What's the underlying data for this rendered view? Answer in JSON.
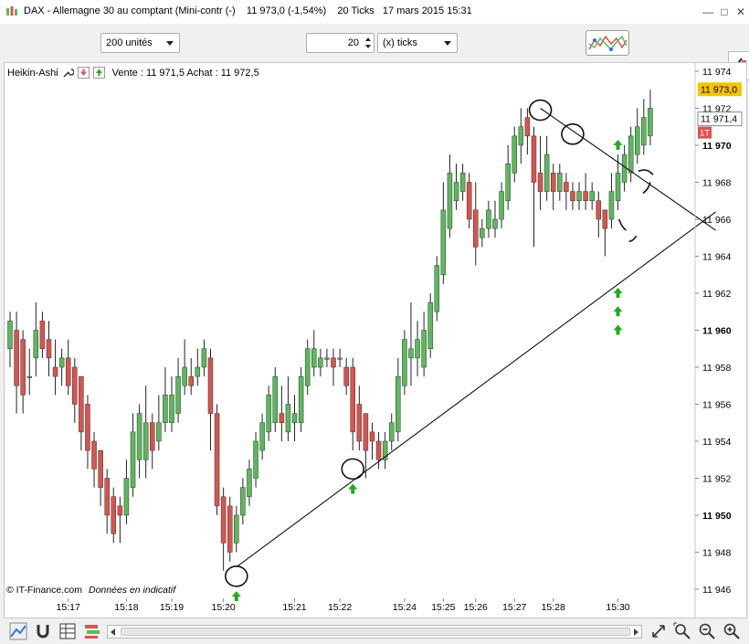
{
  "window": {
    "title": "DAX - Allemagne 30 au comptant (Mini-contr (-)    11 973,0 (-1,54%)    20 Ticks   17 mars 2015 15:31"
  },
  "toolbar": {
    "units_select": "200 unités",
    "ticks_value": "20",
    "ticks_select": "(x) ticks"
  },
  "legend": {
    "indicator": "Heikin-Ashi",
    "quote": "Vente : 11 971,5  Achat : 11 972,5"
  },
  "price_axis": {
    "labels": [
      "11 974",
      "11 972",
      "11 970",
      "11 968",
      "11 966",
      "11 964",
      "11 962",
      "11 960",
      "11 958",
      "11 956",
      "11 954",
      "11 952",
      "11 950",
      "11 948",
      "11 946"
    ],
    "bold_labels": [
      "11 970",
      "11 960",
      "11 950"
    ],
    "last_price_tag": "11 973,0",
    "bid_tag": "11 971,4",
    "tick_tag": "1T"
  },
  "time_axis": {
    "labels": [
      "15:17",
      "15:18",
      "15:19",
      "15:20",
      "15:21",
      "15:22",
      "15:24",
      "15:25",
      "15:26",
      "15:27",
      "15:28",
      "15:30"
    ]
  },
  "footer": {
    "copyright": "© IT-Finance.com",
    "note": "Données en indicatif"
  },
  "colors": {
    "up": "#5cb85c",
    "down": "#d9534f",
    "wick": "#222222",
    "last_price_bg": "#f5c400",
    "tick_tag_bg": "#d9534f",
    "arrow": "#22aa22"
  },
  "chart_data": {
    "type": "candlestick",
    "subtype": "Heikin-Ashi",
    "ylim": [
      11946,
      11974
    ],
    "y_ticks": [
      11974,
      11972,
      11970,
      11968,
      11966,
      11964,
      11962,
      11960,
      11958,
      11956,
      11954,
      11952,
      11950,
      11948,
      11946
    ],
    "candles": [
      {
        "o": 11959.0,
        "c": 11960.5,
        "h": 11961.0,
        "l": 11958.0
      },
      {
        "o": 11960.0,
        "c": 11957.0,
        "h": 11961.0,
        "l": 11955.5
      },
      {
        "o": 11959.5,
        "c": 11956.5,
        "h": 11960.0,
        "l": 11955.5
      },
      {
        "o": 11957.5,
        "c": 11957.5,
        "h": 11959.0,
        "l": 11956.5
      },
      {
        "o": 11958.5,
        "c": 11960.0,
        "h": 11961.5,
        "l": 11957.5
      },
      {
        "o": 11960.5,
        "c": 11959.0,
        "h": 11961.0,
        "l": 11958.5
      },
      {
        "o": 11959.5,
        "c": 11958.5,
        "h": 11960.5,
        "l": 11957.5
      },
      {
        "o": 11958.0,
        "c": 11957.5,
        "h": 11959.5,
        "l": 11956.5
      },
      {
        "o": 11958.0,
        "c": 11958.5,
        "h": 11959.0,
        "l": 11957.0
      },
      {
        "o": 11958.5,
        "c": 11957.0,
        "h": 11959.5,
        "l": 11956.5
      },
      {
        "o": 11958.0,
        "c": 11956.0,
        "h": 11958.5,
        "l": 11955.0
      },
      {
        "o": 11957.5,
        "c": 11954.5,
        "h": 11957.5,
        "l": 11953.5
      },
      {
        "o": 11956.0,
        "c": 11953.5,
        "h": 11956.5,
        "l": 11952.5
      },
      {
        "o": 11954.0,
        "c": 11952.5,
        "h": 11954.5,
        "l": 11951.5
      },
      {
        "o": 11953.5,
        "c": 11951.5,
        "h": 11953.5,
        "l": 11950.5
      },
      {
        "o": 11952.0,
        "c": 11950.0,
        "h": 11952.5,
        "l": 11949.0
      },
      {
        "o": 11951.0,
        "c": 11949.0,
        "h": 11951.5,
        "l": 11948.5
      },
      {
        "o": 11950.5,
        "c": 11950.0,
        "h": 11951.0,
        "l": 11948.5
      },
      {
        "o": 11950.0,
        "c": 11952.0,
        "h": 11953.0,
        "l": 11949.5
      },
      {
        "o": 11951.5,
        "c": 11954.5,
        "h": 11955.5,
        "l": 11951.0
      },
      {
        "o": 11953.0,
        "c": 11955.5,
        "h": 11956.0,
        "l": 11952.0
      },
      {
        "o": 11953.0,
        "c": 11955.0,
        "h": 11957.0,
        "l": 11952.0
      },
      {
        "o": 11955.0,
        "c": 11953.5,
        "h": 11955.5,
        "l": 11952.5
      },
      {
        "o": 11954.0,
        "c": 11955.0,
        "h": 11956.5,
        "l": 11953.5
      },
      {
        "o": 11955.0,
        "c": 11956.5,
        "h": 11958.0,
        "l": 11954.5
      },
      {
        "o": 11955.0,
        "c": 11956.5,
        "h": 11957.5,
        "l": 11954.5
      },
      {
        "o": 11955.5,
        "c": 11957.5,
        "h": 11958.5,
        "l": 11955.0
      },
      {
        "o": 11957.0,
        "c": 11958.0,
        "h": 11959.5,
        "l": 11956.5
      },
      {
        "o": 11957.5,
        "c": 11957.0,
        "h": 11958.5,
        "l": 11956.5
      },
      {
        "o": 11957.5,
        "c": 11958.0,
        "h": 11959.0,
        "l": 11957.0
      },
      {
        "o": 11958.0,
        "c": 11959.0,
        "h": 11959.5,
        "l": 11957.5
      },
      {
        "o": 11958.5,
        "c": 11955.5,
        "h": 11959.0,
        "l": 11953.5
      },
      {
        "o": 11955.5,
        "c": 11950.5,
        "h": 11956.0,
        "l": 11950.0
      },
      {
        "o": 11951.0,
        "c": 11948.5,
        "h": 11951.5,
        "l": 11947.0
      },
      {
        "o": 11950.5,
        "c": 11948.0,
        "h": 11951.0,
        "l": 11947.5
      },
      {
        "o": 11948.5,
        "c": 11950.0,
        "h": 11950.5,
        "l": 11948.0
      },
      {
        "o": 11950.0,
        "c": 11951.5,
        "h": 11952.0,
        "l": 11949.5
      },
      {
        "o": 11951.0,
        "c": 11952.5,
        "h": 11953.0,
        "l": 11950.5
      },
      {
        "o": 11952.0,
        "c": 11954.0,
        "h": 11954.5,
        "l": 11951.5
      },
      {
        "o": 11953.5,
        "c": 11955.0,
        "h": 11955.5,
        "l": 11953.0
      },
      {
        "o": 11954.5,
        "c": 11956.5,
        "h": 11957.0,
        "l": 11954.0
      },
      {
        "o": 11955.0,
        "c": 11957.5,
        "h": 11958.0,
        "l": 11954.5
      },
      {
        "o": 11955.5,
        "c": 11955.0,
        "h": 11957.0,
        "l": 11954.0
      },
      {
        "o": 11954.5,
        "c": 11956.0,
        "h": 11957.5,
        "l": 11954.0
      },
      {
        "o": 11955.0,
        "c": 11955.5,
        "h": 11956.5,
        "l": 11954.0
      },
      {
        "o": 11955.0,
        "c": 11957.5,
        "h": 11958.0,
        "l": 11954.5
      },
      {
        "o": 11957.0,
        "c": 11959.0,
        "h": 11959.5,
        "l": 11956.5
      },
      {
        "o": 11958.0,
        "c": 11959.0,
        "h": 11960.0,
        "l": 11957.5
      },
      {
        "o": 11958.0,
        "c": 11958.5,
        "h": 11959.0,
        "l": 11957.5
      },
      {
        "o": 11958.5,
        "c": 11958.5,
        "h": 11959.0,
        "l": 11958.0
      },
      {
        "o": 11958.5,
        "c": 11958.0,
        "h": 11959.0,
        "l": 11957.0
      },
      {
        "o": 11958.5,
        "c": 11958.5,
        "h": 11959.0,
        "l": 11958.0
      },
      {
        "o": 11958.0,
        "c": 11957.0,
        "h": 11958.5,
        "l": 11956.5
      },
      {
        "o": 11958.0,
        "c": 11954.5,
        "h": 11958.5,
        "l": 11953.5
      },
      {
        "o": 11956.0,
        "c": 11954.0,
        "h": 11957.0,
        "l": 11953.5
      },
      {
        "o": 11955.5,
        "c": 11953.5,
        "h": 11955.5,
        "l": 11952.0
      },
      {
        "o": 11954.5,
        "c": 11954.0,
        "h": 11955.0,
        "l": 11953.0
      },
      {
        "o": 11954.0,
        "c": 11953.0,
        "h": 11954.5,
        "l": 11952.5
      },
      {
        "o": 11953.0,
        "c": 11954.0,
        "h": 11954.5,
        "l": 11952.5
      },
      {
        "o": 11954.0,
        "c": 11955.0,
        "h": 11955.5,
        "l": 11953.5
      },
      {
        "o": 11954.5,
        "c": 11957.5,
        "h": 11958.5,
        "l": 11954.0
      },
      {
        "o": 11957.0,
        "c": 11959.5,
        "h": 11960.0,
        "l": 11956.5
      },
      {
        "o": 11958.5,
        "c": 11959.0,
        "h": 11961.5,
        "l": 11957.0
      },
      {
        "o": 11958.5,
        "c": 11959.5,
        "h": 11960.5,
        "l": 11957.5
      },
      {
        "o": 11958.0,
        "c": 11960.0,
        "h": 11961.0,
        "l": 11957.5
      },
      {
        "o": 11959.0,
        "c": 11961.5,
        "h": 11962.0,
        "l": 11958.5
      },
      {
        "o": 11961.0,
        "c": 11963.5,
        "h": 11964.0,
        "l": 11960.5
      },
      {
        "o": 11963.0,
        "c": 11966.5,
        "h": 11968.0,
        "l": 11962.5
      },
      {
        "o": 11965.5,
        "c": 11968.5,
        "h": 11969.5,
        "l": 11965.0
      },
      {
        "o": 11967.0,
        "c": 11968.0,
        "h": 11969.0,
        "l": 11966.5
      },
      {
        "o": 11967.5,
        "c": 11968.5,
        "h": 11969.0,
        "l": 11967.0
      },
      {
        "o": 11968.0,
        "c": 11966.0,
        "h": 11968.5,
        "l": 11965.5
      },
      {
        "o": 11966.5,
        "c": 11964.5,
        "h": 11968.0,
        "l": 11963.5
      },
      {
        "o": 11965.0,
        "c": 11965.5,
        "h": 11966.0,
        "l": 11964.5
      },
      {
        "o": 11965.5,
        "c": 11966.5,
        "h": 11967.0,
        "l": 11965.0
      },
      {
        "o": 11965.5,
        "c": 11966.0,
        "h": 11967.0,
        "l": 11965.0
      },
      {
        "o": 11966.0,
        "c": 11967.5,
        "h": 11968.0,
        "l": 11965.5
      },
      {
        "o": 11967.0,
        "c": 11969.0,
        "h": 11970.0,
        "l": 11966.5
      },
      {
        "o": 11968.5,
        "c": 11970.5,
        "h": 11971.0,
        "l": 11968.0
      },
      {
        "o": 11970.0,
        "c": 11971.0,
        "h": 11972.0,
        "l": 11969.0
      },
      {
        "o": 11971.5,
        "c": 11970.5,
        "h": 11972.0,
        "l": 11969.5
      },
      {
        "o": 11970.5,
        "c": 11968.0,
        "h": 11971.0,
        "l": 11964.5
      },
      {
        "o": 11968.5,
        "c": 11967.5,
        "h": 11970.5,
        "l": 11966.5
      },
      {
        "o": 11967.5,
        "c": 11969.5,
        "h": 11970.5,
        "l": 11967.0
      },
      {
        "o": 11968.5,
        "c": 11967.5,
        "h": 11969.0,
        "l": 11966.5
      },
      {
        "o": 11967.5,
        "c": 11968.5,
        "h": 11969.0,
        "l": 11967.0
      },
      {
        "o": 11968.0,
        "c": 11967.5,
        "h": 11968.5,
        "l": 11966.5
      },
      {
        "o": 11967.5,
        "c": 11967.0,
        "h": 11968.0,
        "l": 11966.5
      },
      {
        "o": 11967.0,
        "c": 11967.5,
        "h": 11968.0,
        "l": 11966.5
      },
      {
        "o": 11967.5,
        "c": 11967.0,
        "h": 11968.5,
        "l": 11966.5
      },
      {
        "o": 11967.0,
        "c": 11967.5,
        "h": 11968.0,
        "l": 11966.5
      },
      {
        "o": 11967.0,
        "c": 11966.0,
        "h": 11967.5,
        "l": 11965.0
      },
      {
        "o": 11966.5,
        "c": 11965.5,
        "h": 11966.5,
        "l": 11964.0
      },
      {
        "o": 11966.0,
        "c": 11967.5,
        "h": 11968.5,
        "l": 11965.5
      },
      {
        "o": 11967.0,
        "c": 11968.5,
        "h": 11969.5,
        "l": 11966.5
      },
      {
        "o": 11968.0,
        "c": 11969.5,
        "h": 11970.0,
        "l": 11967.5
      },
      {
        "o": 11968.5,
        "c": 11970.5,
        "h": 11971.0,
        "l": 11968.0
      },
      {
        "o": 11969.5,
        "c": 11971.0,
        "h": 11972.0,
        "l": 11969.0
      },
      {
        "o": 11970.0,
        "c": 11971.5,
        "h": 11972.5,
        "l": 11969.5
      },
      {
        "o": 11970.5,
        "c": 11972.0,
        "h": 11973.0,
        "l": 11970.0
      }
    ],
    "drawings": {
      "trendlines": [
        {
          "from": {
            "i": 35,
            "v": 11947.2
          },
          "to": {
            "i": 108,
            "v": 11966.4
          }
        },
        {
          "from": {
            "i": 82,
            "v": 11972.0
          },
          "to": {
            "i": 108,
            "v": 11965.4
          }
        }
      ],
      "circled_candles": [
        {
          "i": 35,
          "v": 11946.7
        },
        {
          "i": 53,
          "v": 11952.5
        },
        {
          "i": 82,
          "v": 11971.9
        },
        {
          "i": 87,
          "v": 11970.6
        }
      ],
      "buy_arrows": [
        {
          "i": 35,
          "v": 11945.6
        },
        {
          "i": 53,
          "v": 11951.4
        },
        {
          "i": 94,
          "v": 11970.0
        },
        {
          "i": 94,
          "v": 11962.0
        },
        {
          "i": 94,
          "v": 11961.0
        },
        {
          "i": 94,
          "v": 11960.0
        }
      ]
    }
  }
}
